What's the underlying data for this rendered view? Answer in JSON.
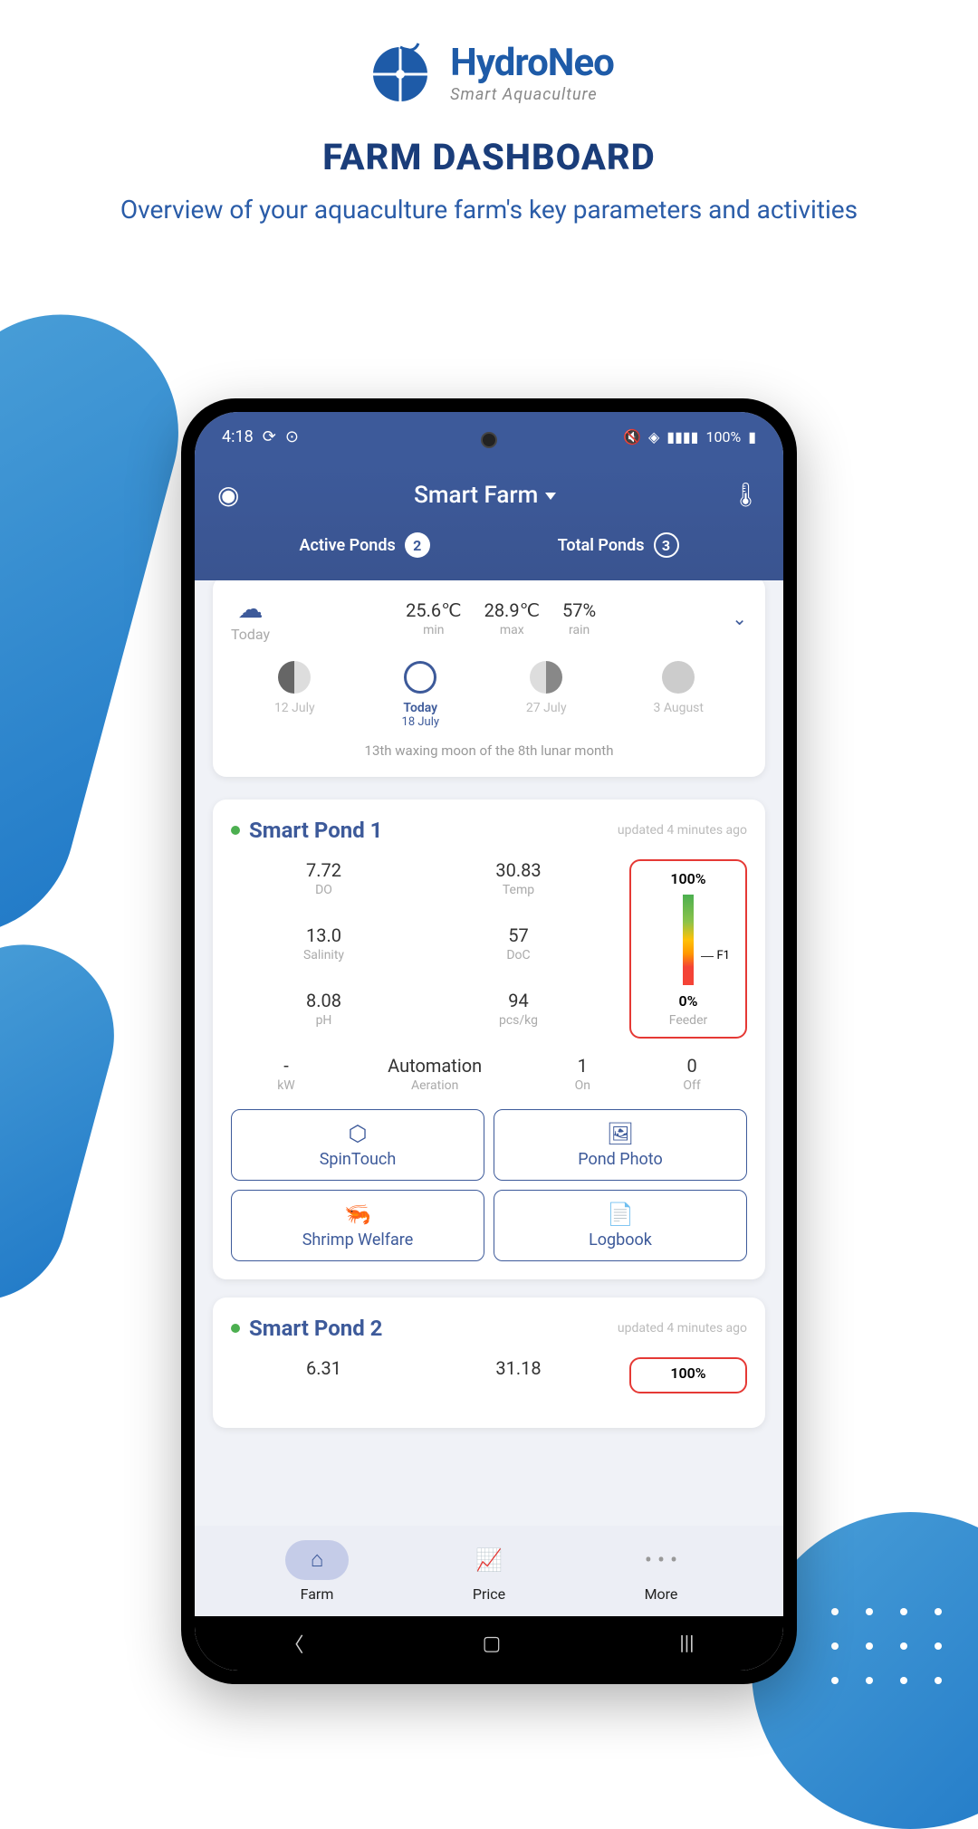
{
  "brand": {
    "name": "HydroNeo",
    "tagline": "Smart Aquaculture"
  },
  "page_title": "FARM DASHBOARD",
  "page_sub": "Overview of your aquaculture farm's key parameters and activities",
  "status_bar": {
    "time": "4:18",
    "battery": "100%"
  },
  "app_header": {
    "farm_name": "Smart Farm",
    "active_label": "Active Ponds",
    "active_count": "2",
    "total_label": "Total Ponds",
    "total_count": "3"
  },
  "weather": {
    "today_label": "Today",
    "min_val": "25.6℃",
    "min_lab": "min",
    "max_val": "28.9℃",
    "max_lab": "max",
    "rain_val": "57%",
    "rain_lab": "rain",
    "moons": [
      {
        "date": "12 July"
      },
      {
        "date": "Today",
        "date2": "18 July"
      },
      {
        "date": "27 July"
      },
      {
        "date": "3 August"
      }
    ],
    "lunar": "13th waxing moon of the 8th lunar month"
  },
  "ponds": [
    {
      "name": "Smart Pond 1",
      "updated": "updated 4 minutes ago",
      "metrics": {
        "do_val": "7.72",
        "do_lab": "DO",
        "temp_val": "30.83",
        "temp_lab": "Temp",
        "sal_val": "13.0",
        "sal_lab": "Salinity",
        "doc_val": "57",
        "doc_lab": "DoC",
        "ph_val": "8.08",
        "ph_lab": "pH",
        "pcs_val": "94",
        "pcs_lab": "pcs/kg"
      },
      "feeder": {
        "top": "100%",
        "bot": "0%",
        "marker": "F1",
        "label": "Feeder"
      },
      "auto": {
        "kw_val": "-",
        "kw_lab": "kW",
        "auto_val": "Automation",
        "auto_lab": "Aeration",
        "on_val": "1",
        "on_lab": "On",
        "off_val": "0",
        "off_lab": "Off"
      },
      "actions": {
        "spintouch": "SpinTouch",
        "photo": "Pond Photo",
        "welfare": "Shrimp Welfare",
        "logbook": "Logbook"
      }
    },
    {
      "name": "Smart Pond 2",
      "updated": "updated 4 minutes ago",
      "m1": "6.31",
      "m2": "31.18",
      "feeder_top": "100%"
    }
  ],
  "nav": {
    "farm": "Farm",
    "price": "Price",
    "more": "More"
  }
}
